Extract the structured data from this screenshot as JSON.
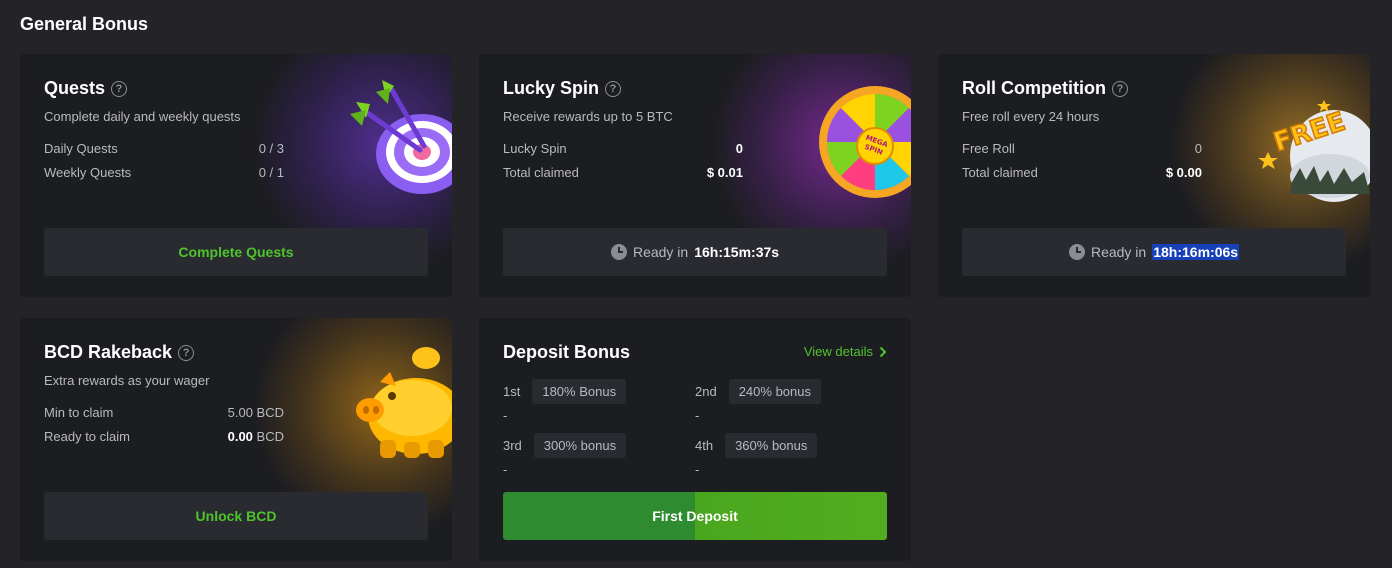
{
  "section_title": "General Bonus",
  "quests": {
    "title": "Quests",
    "subtitle": "Complete daily and weekly quests",
    "rows": [
      {
        "label": "Daily Quests",
        "value": "0 / 3"
      },
      {
        "label": "Weekly Quests",
        "value": "0 / 1"
      }
    ],
    "button": "Complete Quests"
  },
  "lucky_spin": {
    "title": "Lucky Spin",
    "subtitle": "Receive rewards up to 5 BTC",
    "rows": [
      {
        "label": "Lucky Spin",
        "value": "0"
      },
      {
        "label": "Total claimed",
        "value": "$ 0.01"
      }
    ],
    "ready_label": "Ready in",
    "ready_time": "16h:15m:37s",
    "wheel_text": "MEGA SPIN"
  },
  "roll": {
    "title": "Roll Competition",
    "subtitle": "Free roll every 24 hours",
    "rows": [
      {
        "label": "Free Roll",
        "value": "0"
      },
      {
        "label": "Total claimed",
        "value": "$ 0.00"
      }
    ],
    "ready_label": "Ready in",
    "ready_time": "18h:16m:06s",
    "badge_text": "FREE"
  },
  "rakeback": {
    "title": "BCD Rakeback",
    "subtitle": "Extra rewards as your wager",
    "rows": [
      {
        "label": "Min to claim",
        "value": "5.00 BCD"
      },
      {
        "label": "Ready to claim",
        "value_bold": "0.00",
        "unit": "BCD"
      }
    ],
    "button": "Unlock BCD"
  },
  "deposit": {
    "title": "Deposit Bonus",
    "view_details": "View details",
    "tiers": [
      {
        "label": "1st",
        "bonus": "180% Bonus",
        "status": "-"
      },
      {
        "label": "2nd",
        "bonus": "240% bonus",
        "status": "-"
      },
      {
        "label": "3rd",
        "bonus": "300% bonus",
        "status": "-"
      },
      {
        "label": "4th",
        "bonus": "360% bonus",
        "status": "-"
      }
    ],
    "button": "First Deposit"
  },
  "colors": {
    "accent_green": "#4ec42c",
    "card_bg": "#1c1d21",
    "page_bg": "#232328",
    "selection_blue": "#1540b8"
  }
}
